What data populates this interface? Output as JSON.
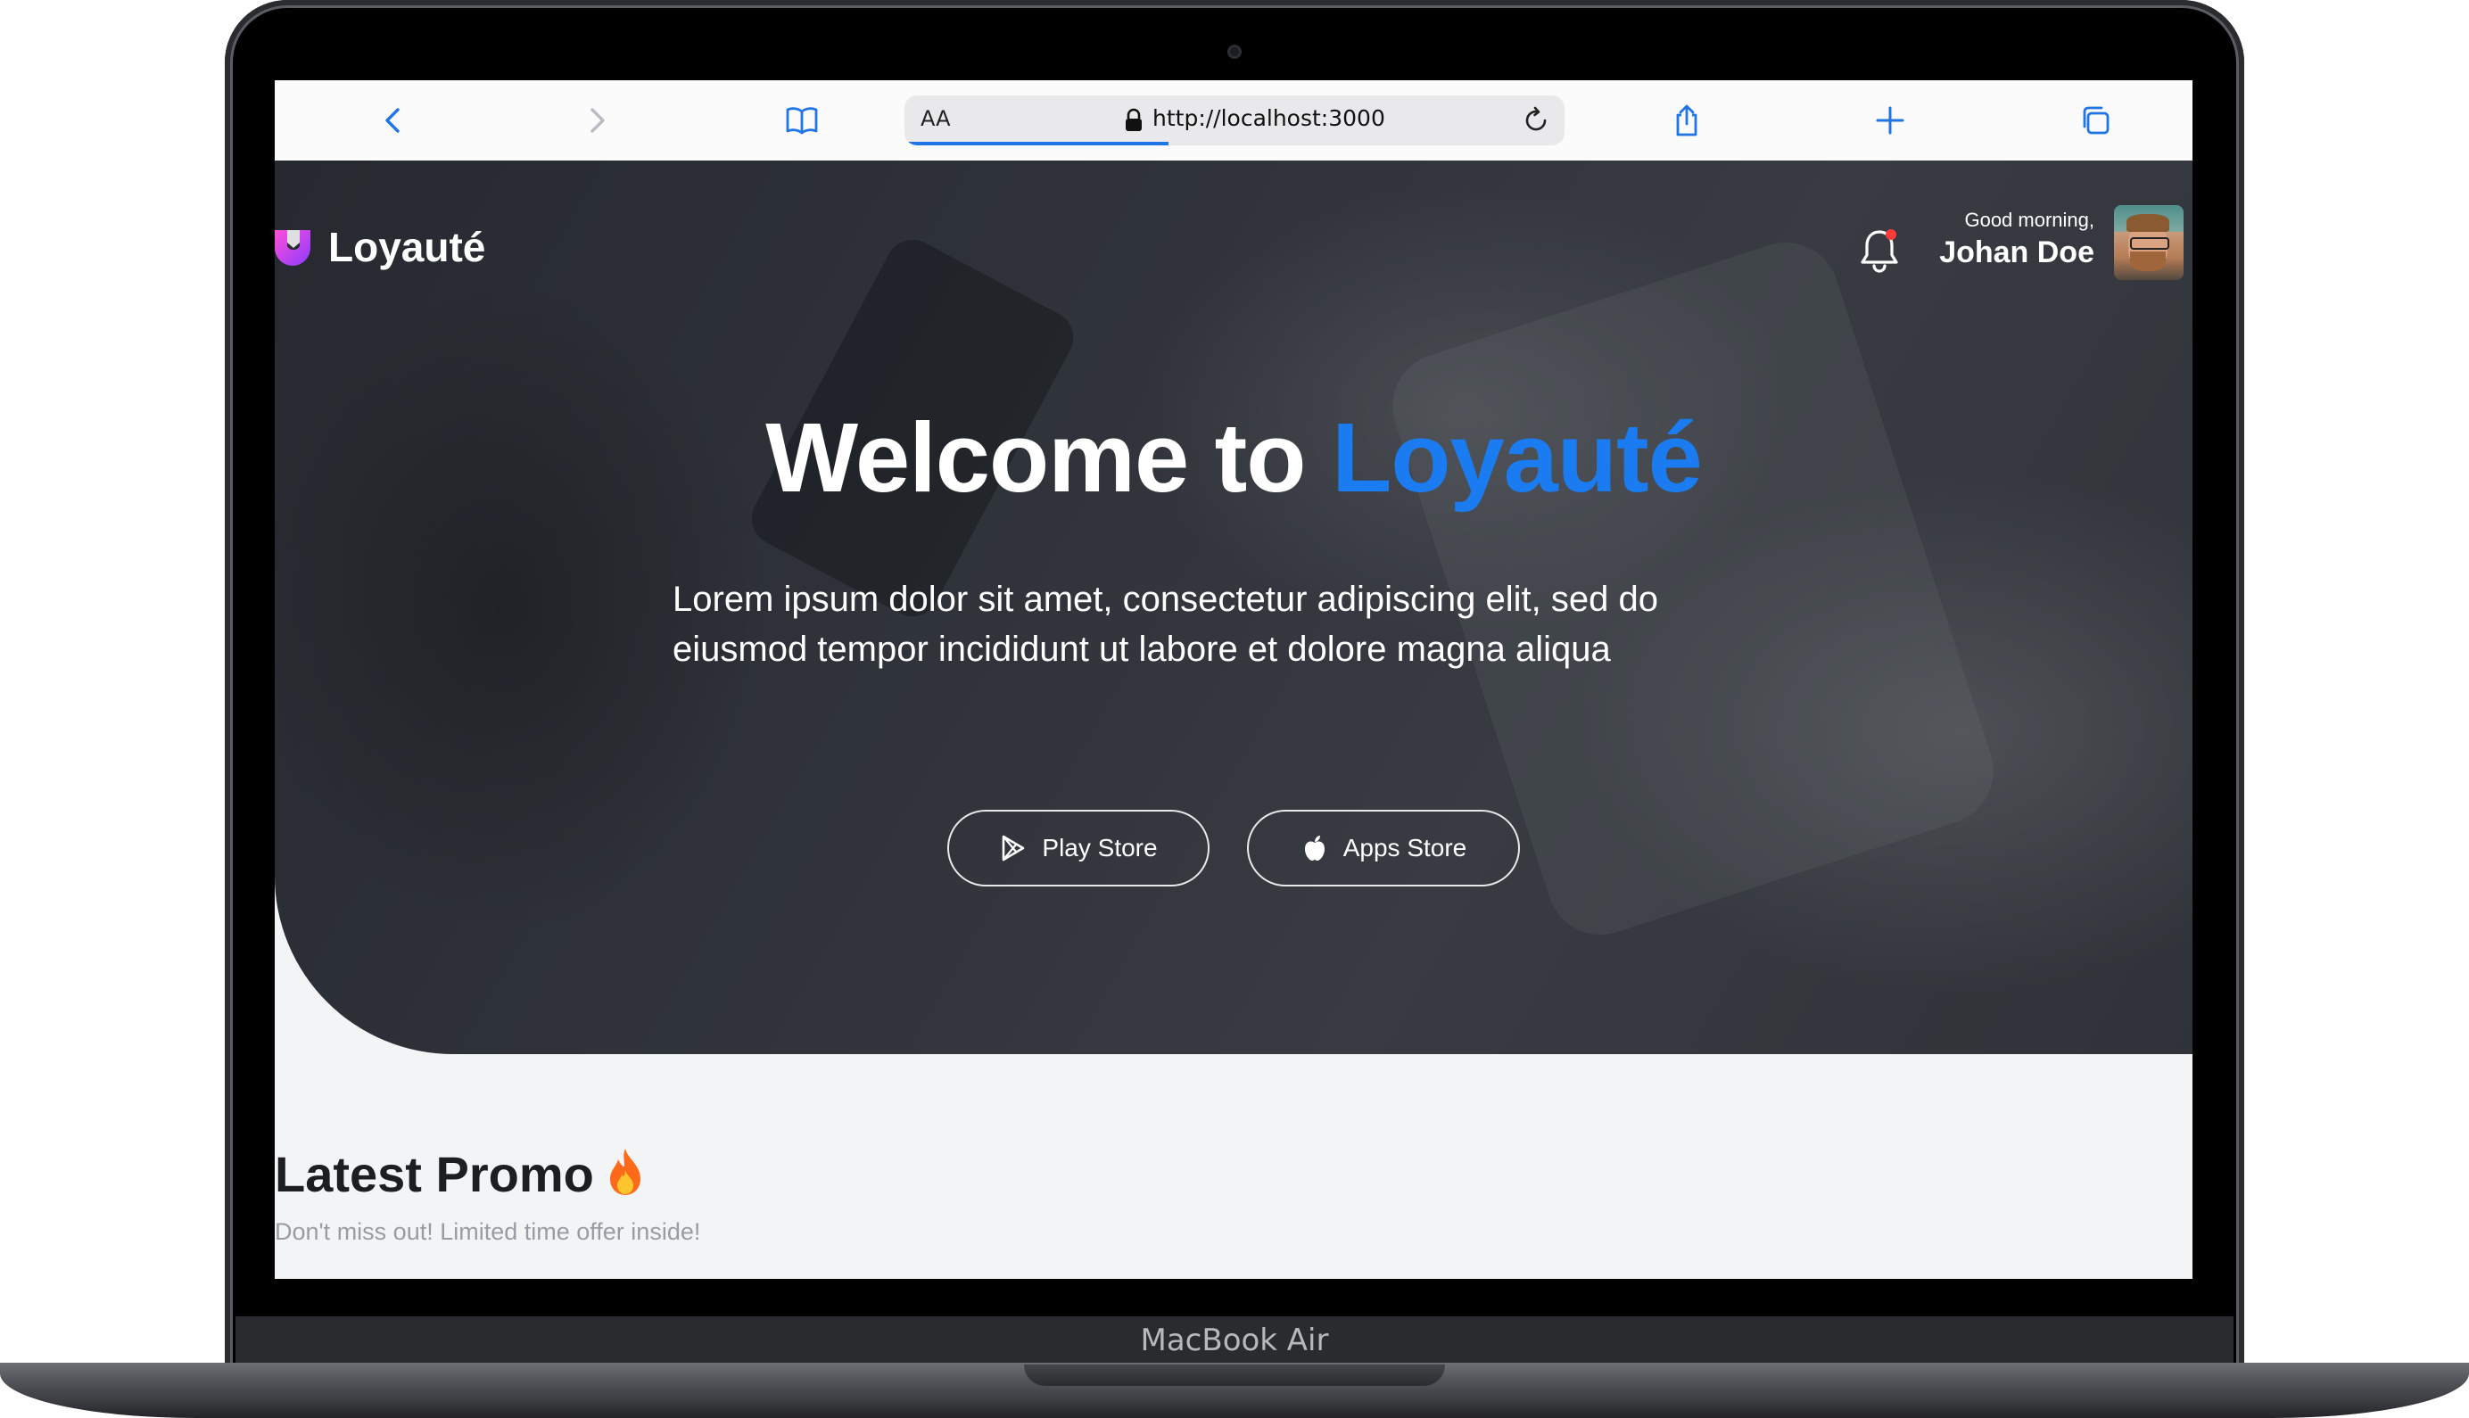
{
  "device": {
    "label": "MacBook Air"
  },
  "browser": {
    "text_size_label": "AA",
    "url": "http://localhost:3000",
    "progress": 0.4
  },
  "header": {
    "brand": "Loyauté",
    "greeting": "Good morning,",
    "user_name": "Johan Doe",
    "notification_icon": "bell-icon"
  },
  "hero": {
    "title_prefix": "Welcome to",
    "title_accent": "Loyauté",
    "description": "Lorem ipsum dolor sit amet, consectetur adipiscing elit, sed do eiusmod tempor incididunt ut labore et dolore magna aliqua",
    "play_store_label": "Play Store",
    "apps_store_label": "Apps Store"
  },
  "promo": {
    "title": "Latest Promo",
    "subtitle": "Don't miss out! Limited time offer inside!"
  },
  "colors": {
    "accent": "#1a7cf0",
    "browser_icon": "#1f74e6",
    "promo_title": "#1d1e22",
    "promo_subtitle": "#9a9ca3"
  }
}
